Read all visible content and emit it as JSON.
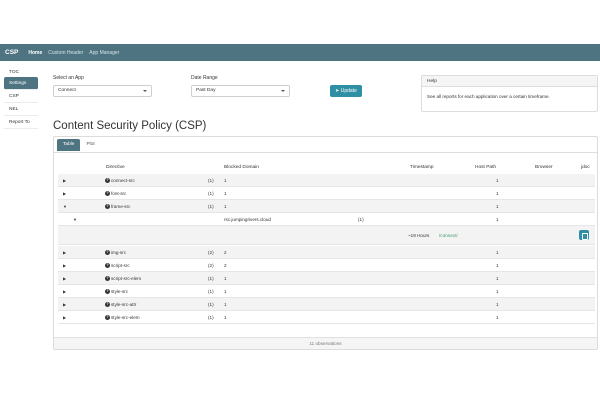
{
  "navbar": {
    "brand": "CSP",
    "links": [
      {
        "label": "Home"
      },
      {
        "label": "Custom Header"
      },
      {
        "label": "App Manager"
      }
    ]
  },
  "sidebar": {
    "items": [
      {
        "label": "TOC"
      },
      {
        "label": "Settings"
      },
      {
        "label": "CSP"
      },
      {
        "label": "NEL"
      },
      {
        "label": "Report To"
      }
    ]
  },
  "filters": {
    "app_label": "Select an App",
    "app_value": "Connect",
    "date_label": "Date Range",
    "date_value": "Past Day",
    "update_label": "Update"
  },
  "help": {
    "title": "Help",
    "text": "See all reports for each application over a certain timeframe."
  },
  "page": {
    "title": "Content Security Policy (CSP)"
  },
  "tabs": [
    {
      "label": "Table"
    },
    {
      "label": "Plot"
    }
  ],
  "table": {
    "headers": {
      "directive": "Directive",
      "blocked": "Blocked Domain",
      "timestamp": "Timestamp",
      "hostpath": "Host Path",
      "browser": "Browser",
      "jdoc": "jdoc"
    },
    "rows": [
      {
        "directive": "connect-src",
        "count": "(1)",
        "blocked": "1",
        "host": "1"
      },
      {
        "directive": "font-src",
        "count": "(1)",
        "blocked": "1",
        "host": "1"
      },
      {
        "directive": "frame-src",
        "count": "(1)",
        "blocked": "1",
        "host": "1"
      },
      {
        "directive": "img-src",
        "count": "(2)",
        "blocked": "2",
        "host": "1"
      },
      {
        "directive": "script-src",
        "count": "(2)",
        "blocked": "2",
        "host": "1"
      },
      {
        "directive": "script-src-elem",
        "count": "(1)",
        "blocked": "1",
        "host": "1"
      },
      {
        "directive": "style-src",
        "count": "(1)",
        "blocked": "1",
        "host": "1"
      },
      {
        "directive": "style-src-attr",
        "count": "(1)",
        "blocked": "1",
        "host": "1"
      },
      {
        "directive": "style-src-elem",
        "count": "(1)",
        "blocked": "1",
        "host": "1"
      }
    ],
    "subrow": {
      "domain": "rsc.jumpingrivers.cloud",
      "count": "(1)",
      "host": "1"
    },
    "detail": {
      "time": "~19 Hours",
      "path": "/connect/"
    },
    "footer": "11 observations"
  }
}
